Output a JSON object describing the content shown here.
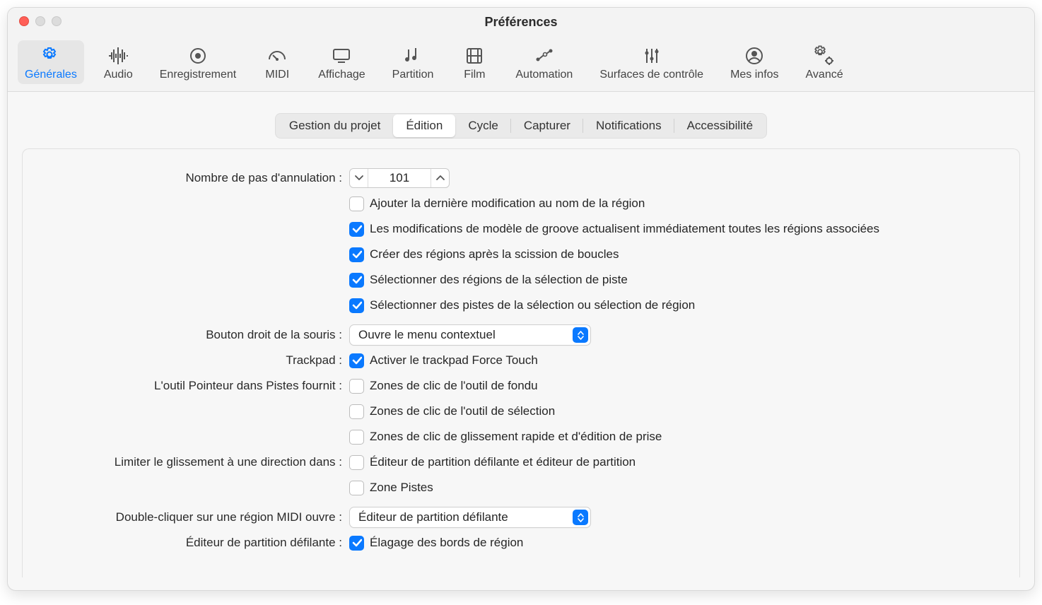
{
  "window": {
    "title": "Préférences"
  },
  "toolbar": [
    {
      "id": "general",
      "label": "Générales",
      "icon": "gear",
      "active": true
    },
    {
      "id": "audio",
      "label": "Audio",
      "icon": "wave",
      "active": false
    },
    {
      "id": "record",
      "label": "Enregistrement",
      "icon": "record",
      "active": false
    },
    {
      "id": "midi",
      "label": "MIDI",
      "icon": "gauge",
      "active": false
    },
    {
      "id": "display",
      "label": "Affichage",
      "icon": "monitor",
      "active": false
    },
    {
      "id": "score",
      "label": "Partition",
      "icon": "notes",
      "active": false
    },
    {
      "id": "film",
      "label": "Film",
      "icon": "film",
      "active": false
    },
    {
      "id": "auto",
      "label": "Automation",
      "icon": "curve",
      "active": false
    },
    {
      "id": "surfaces",
      "label": "Surfaces de contrôle",
      "icon": "sliders",
      "active": false
    },
    {
      "id": "myinfo",
      "label": "Mes infos",
      "icon": "user",
      "active": false
    },
    {
      "id": "advanced",
      "label": "Avancé",
      "icon": "gears",
      "active": false
    }
  ],
  "tabs": [
    {
      "id": "proj",
      "label": "Gestion du projet",
      "active": false
    },
    {
      "id": "edit",
      "label": "Édition",
      "active": true
    },
    {
      "id": "cycle",
      "label": "Cycle",
      "active": false
    },
    {
      "id": "capt",
      "label": "Capturer",
      "active": false
    },
    {
      "id": "notif",
      "label": "Notifications",
      "active": false
    },
    {
      "id": "access",
      "label": "Accessibilité",
      "active": false
    }
  ],
  "form": {
    "undo_label": "Nombre de pas d'annulation :",
    "undo_value": "101",
    "cb1": {
      "checked": false,
      "label": "Ajouter la dernière modification au nom de la région"
    },
    "cb2": {
      "checked": true,
      "label": "Les modifications de modèle de groove actualisent immédiatement toutes les régions associées"
    },
    "cb3": {
      "checked": true,
      "label": "Créer des régions après la scission de boucles"
    },
    "cb4": {
      "checked": true,
      "label": "Sélectionner des régions de la sélection de piste"
    },
    "cb5": {
      "checked": true,
      "label": "Sélectionner des pistes de la sélection ou sélection de région"
    },
    "rmb_label": "Bouton droit de la souris :",
    "rmb_value": "Ouvre le menu contextuel",
    "trackpad_label": "Trackpad :",
    "cb6": {
      "checked": true,
      "label": "Activer le trackpad Force Touch"
    },
    "pointer_label": "L'outil Pointeur dans Pistes fournit :",
    "cb7": {
      "checked": false,
      "label": "Zones de clic de l'outil de fondu"
    },
    "cb8": {
      "checked": false,
      "label": "Zones de clic de l'outil de sélection"
    },
    "cb9": {
      "checked": false,
      "label": "Zones de clic de glissement rapide et d'édition de prise"
    },
    "limit_label": "Limiter le glissement à une direction dans :",
    "cb10": {
      "checked": false,
      "label": "Éditeur de partition défilante et éditeur de partition"
    },
    "cb11": {
      "checked": false,
      "label": "Zone Pistes"
    },
    "dblclick_label": "Double-cliquer sur une région MIDI ouvre :",
    "dblclick_value": "Éditeur de partition défilante",
    "pianoroll_label": "Éditeur de partition défilante :",
    "cb12": {
      "checked": true,
      "label": "Élagage des bords de région"
    }
  }
}
